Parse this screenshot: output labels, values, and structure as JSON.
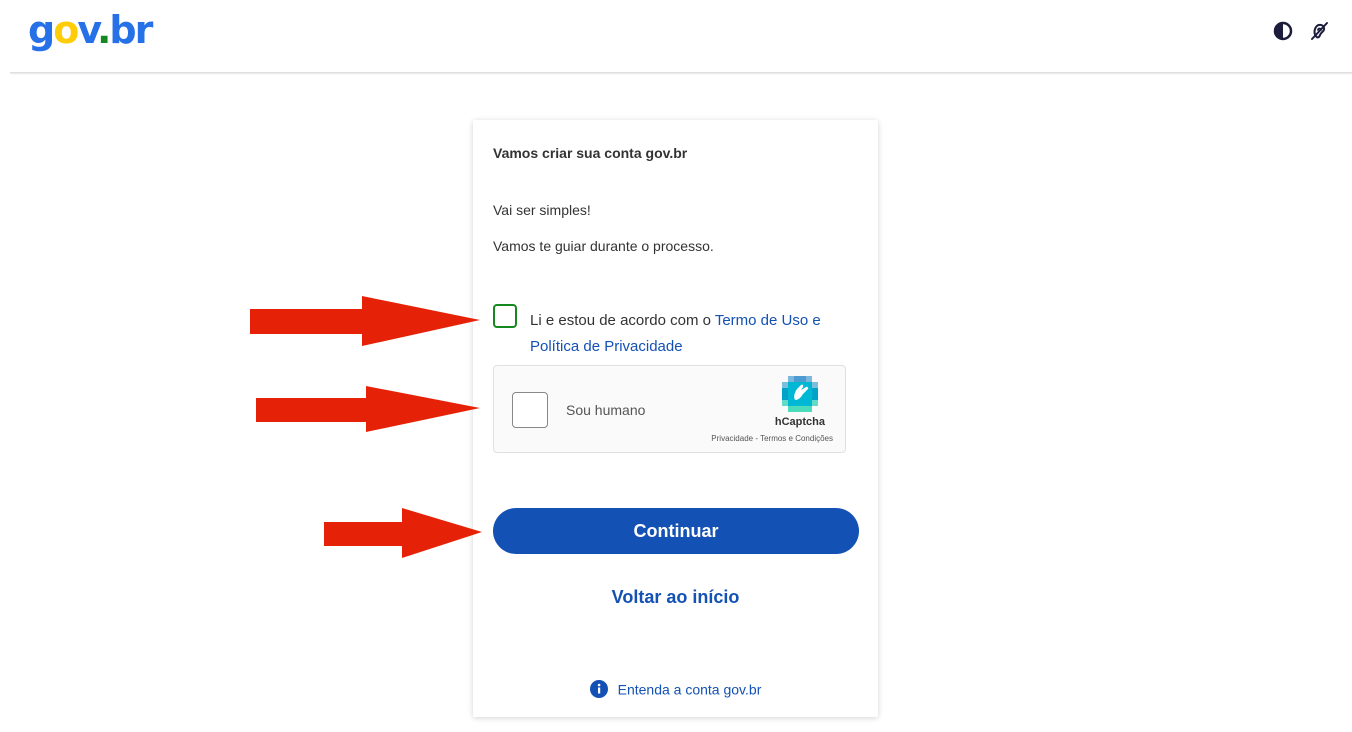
{
  "header": {
    "logo": {
      "g": "g",
      "o": "o",
      "v": "v",
      "dot": ".",
      "b": "b",
      "r": "r"
    },
    "icons": [
      "contrast-icon",
      "accessibility-icon"
    ]
  },
  "card": {
    "title": "Vamos criar sua conta gov.br",
    "line1": "Vai ser simples!",
    "line2": "Vamos te guiar durante o processo.",
    "terms": {
      "prefix": "Li e estou de acordo com o ",
      "link": "Termo de Uso e Política de Privacidade"
    },
    "captcha": {
      "label": "Sou humano",
      "brand": "hCaptcha",
      "privacy": "Privacidade",
      "separator": " - ",
      "terms": "Termos e Condições"
    },
    "continue_label": "Continuar",
    "back_label": "Voltar ao início",
    "about_label": "Entenda a conta gov.br"
  },
  "colors": {
    "primary": "#1351b4",
    "checkbox_border": "#168821",
    "annotation_arrow": "#e52207"
  }
}
